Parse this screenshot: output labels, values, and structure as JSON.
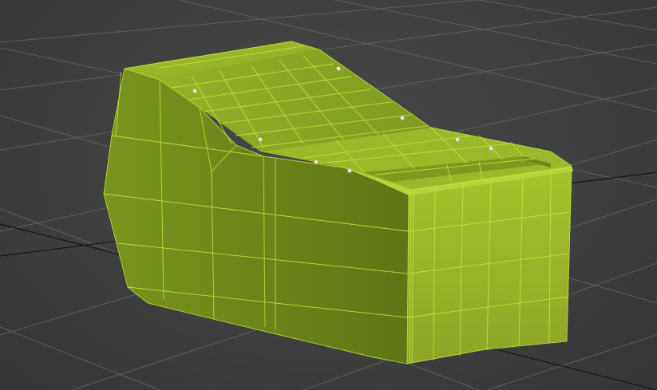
{
  "viewport": {
    "mode": "perspective",
    "background_color": "#3e3e3e",
    "grid_color": "#636363",
    "grid_axis_color": "#111111"
  },
  "object": {
    "shape": "sculpted block with sloped top and recessed tray",
    "selected": true,
    "color_light": "#9cb82a",
    "color_mid": "#7e9a1f",
    "color_dark": "#5d7416",
    "wire_color": "#c4e23a",
    "vertex_marker_color": "#e8e4cf"
  }
}
